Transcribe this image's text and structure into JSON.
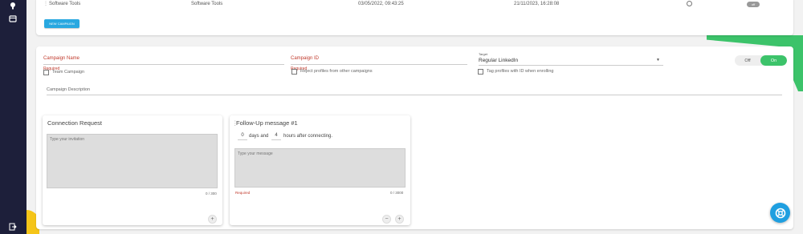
{
  "sidebar": {
    "icons": [
      "bulb-icon",
      "calendar-icon",
      "logout-icon"
    ]
  },
  "campaign_row": {
    "name": "Software Tools",
    "list": "Software Tools",
    "created": "03/05/2022, 09:43:25",
    "updated": "21/11/2023, 16:28:08",
    "status_toggle": "off"
  },
  "new_campaign_label": "NEW CAMPAIGN",
  "form": {
    "campaign_name_label": "Campaign Name",
    "campaign_name_required": "Required",
    "campaign_id_label": "Campaign ID",
    "campaign_id_required": "Required",
    "target_small_label": "Target",
    "target_value": "Regular LinkedIn",
    "off_label": "Off",
    "on_label": "On",
    "team_campaign_label": "Team Campaign",
    "reject_profiles_label": "Reject profiles from other campaigns",
    "tag_profiles_label": "Tag profiles with ID when enrolling",
    "description_label": "Campaign Description"
  },
  "connection_request": {
    "title": "Connection Request",
    "placeholder": "Type your invitation",
    "counter": "0 / 300",
    "add_label": "+"
  },
  "follow_up": {
    "title": "Follow-Up message #1",
    "days_value": "0",
    "days_text": "days and",
    "hours_value": "4",
    "hours_text": "hours after connecting.",
    "placeholder": "Type your message",
    "required": "Required",
    "counter": "0 / 3000",
    "remove_label": "−",
    "add_label": "+"
  },
  "colors": {
    "sidebar": "#1d1f3a",
    "accent_blue": "#29a8e0",
    "accent_green": "#3cc36a",
    "error_red": "#c0392b"
  }
}
